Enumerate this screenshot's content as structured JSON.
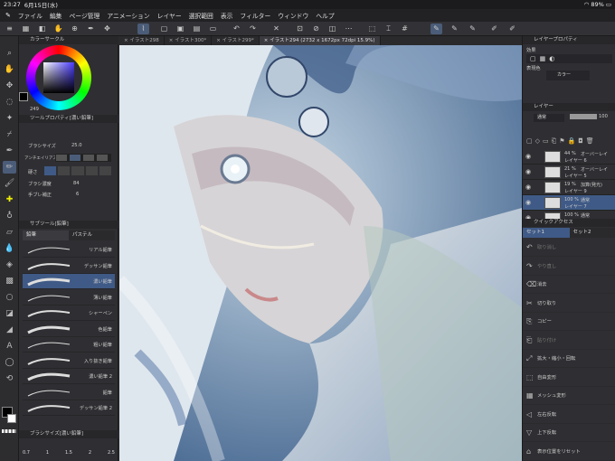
{
  "status": {
    "time": "23:27",
    "date": "6月15日(水)",
    "battery": "89%"
  },
  "menu": [
    "ファイル",
    "編集",
    "ページ管理",
    "アニメーション",
    "レイヤー",
    "選択範囲",
    "表示",
    "フィルター",
    "ウィンドウ",
    "ヘルプ"
  ],
  "tabs": [
    {
      "label": "イラスト298",
      "active": false
    },
    {
      "label": "イラスト300*",
      "active": false
    },
    {
      "label": "イラスト299*",
      "active": false
    },
    {
      "label": "イラスト294 (2732 x 1672px 72dpi 15.9%)",
      "active": true
    }
  ],
  "left": {
    "color_panel_title": "カラーサークル",
    "color_value": "249",
    "tool_prop_title": "ツールプロパティ[濃い鉛筆]",
    "brush_size_label": "ブラシサイズ",
    "brush_size_value": "25.0",
    "aa_label": "アンチエイリアス",
    "hardness_label": "硬さ",
    "density_label": "ブラシ濃度",
    "density_value": "84",
    "stabil_label": "手ブレ補正",
    "stabil_value": "6",
    "subtool_title": "サブツール[鉛筆]",
    "subtool_tabs": [
      "鉛筆",
      "パステル"
    ],
    "brushes": [
      "リアル鉛筆",
      "デッサン鉛筆",
      "濃い鉛筆",
      "薄い鉛筆",
      "シャーペン",
      "色鉛筆",
      "粗い鉛筆",
      "入り抜き鉛筆",
      "濃い鉛筆 2",
      "鉛筆",
      "デッサン鉛筆 2"
    ],
    "selected_brush": "濃い鉛筆",
    "brush_size_panel_title": "ブラシサイズ[濃い鉛筆]",
    "size_presets": [
      "0.7",
      "1",
      "1.5",
      "2",
      "2.5"
    ]
  },
  "right": {
    "layer_prop_title": "レイヤープロパティ",
    "effect_label": "効果",
    "expr_label": "表現色",
    "expr_value": "カラー",
    "layer_title": "レイヤー",
    "blend_mode": "通常",
    "opacity": "100",
    "layers": [
      {
        "pct": "44 %",
        "mode": "オーバーレイ",
        "name": "レイヤー 6"
      },
      {
        "pct": "21 %",
        "mode": "オーバーレイ",
        "name": "レイヤー 5"
      },
      {
        "pct": "19 %",
        "mode": "加算(発光)",
        "name": "レイヤー 9"
      },
      {
        "pct": "100 %",
        "mode": "通常",
        "name": "レイヤー 7"
      },
      {
        "pct": "100 %",
        "mode": "通常",
        "name": ""
      }
    ],
    "quick_title": "クイックアクセス",
    "sets": [
      "セット1",
      "セット2"
    ],
    "actions": [
      {
        "label": "取り消し",
        "dim": true
      },
      {
        "label": "やり直し",
        "dim": true
      },
      {
        "label": "消去",
        "dim": false
      },
      {
        "label": "切り取り",
        "dim": false
      },
      {
        "label": "コピー",
        "dim": false
      },
      {
        "label": "貼り付け",
        "dim": true
      },
      {
        "label": "拡大・縮小・回転",
        "dim": false
      },
      {
        "label": "自由変形",
        "dim": false
      },
      {
        "label": "メッシュ変形",
        "dim": false
      },
      {
        "label": "左右反転",
        "dim": false
      },
      {
        "label": "上下反転",
        "dim": false
      },
      {
        "label": "表示位置をリセット",
        "dim": false
      }
    ]
  },
  "colors": {
    "accent": "#4a5c78",
    "selected": "#3f5a86",
    "panel": "#2f2f33",
    "canvas_bg": "#6d8aa8"
  },
  "icons": [
    "hand-icon",
    "zoom-icon",
    "move-icon",
    "lasso-icon",
    "magic-wand-icon",
    "eyedropper-icon",
    "pen-icon",
    "pencil-icon",
    "brush-icon",
    "eraser-icon",
    "fill-icon",
    "gradient-icon",
    "figure-icon",
    "frame-icon",
    "text-icon",
    "balloon-icon",
    "ruler-icon"
  ]
}
